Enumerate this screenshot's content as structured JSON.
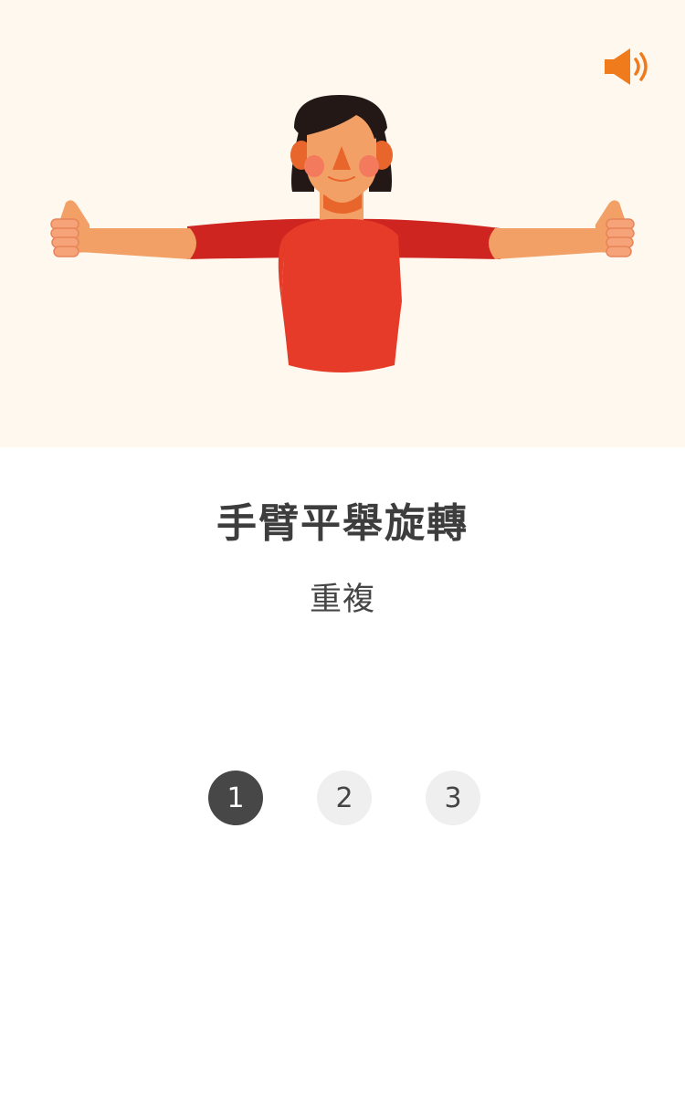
{
  "exercise": {
    "title": "手臂平舉旋轉",
    "subtitle": "重複"
  },
  "sound_button": {
    "icon": "speaker-icon"
  },
  "reps": {
    "selected": 1,
    "options": [
      "1",
      "2",
      "3"
    ]
  },
  "colors": {
    "hero_background": "#fef8ef",
    "accent": "#f07b1d",
    "shirt": "#e63b28",
    "active_rep": "#474747",
    "inactive_rep": "#efefef"
  }
}
